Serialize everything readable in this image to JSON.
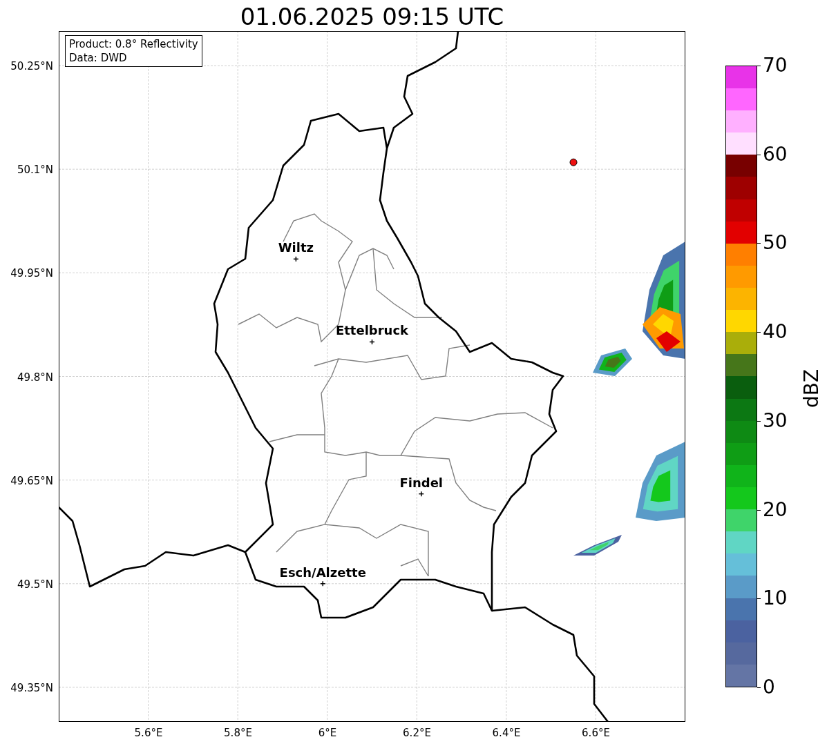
{
  "title": "01.06.2025 09:15 UTC",
  "info_box": [
    "Product: 0.8° Reflectivity",
    "Data: DWD"
  ],
  "map": {
    "lat_ticks": [
      "50.25°N",
      "50.1°N",
      "49.95°N",
      "49.8°N",
      "49.65°N",
      "49.5°N",
      "49.35°N"
    ],
    "lon_ticks": [
      "5.6°E",
      "5.8°E",
      "6°E",
      "6.2°E",
      "6.4°E",
      "6.6°E"
    ],
    "cities": [
      "Wiltz",
      "Ettelbruck",
      "Findel",
      "Esch/Alzette"
    ]
  },
  "colorbar": {
    "label": "dBZ",
    "ticks": [
      "70",
      "60",
      "50",
      "40",
      "30",
      "20",
      "10",
      "0"
    ]
  }
}
